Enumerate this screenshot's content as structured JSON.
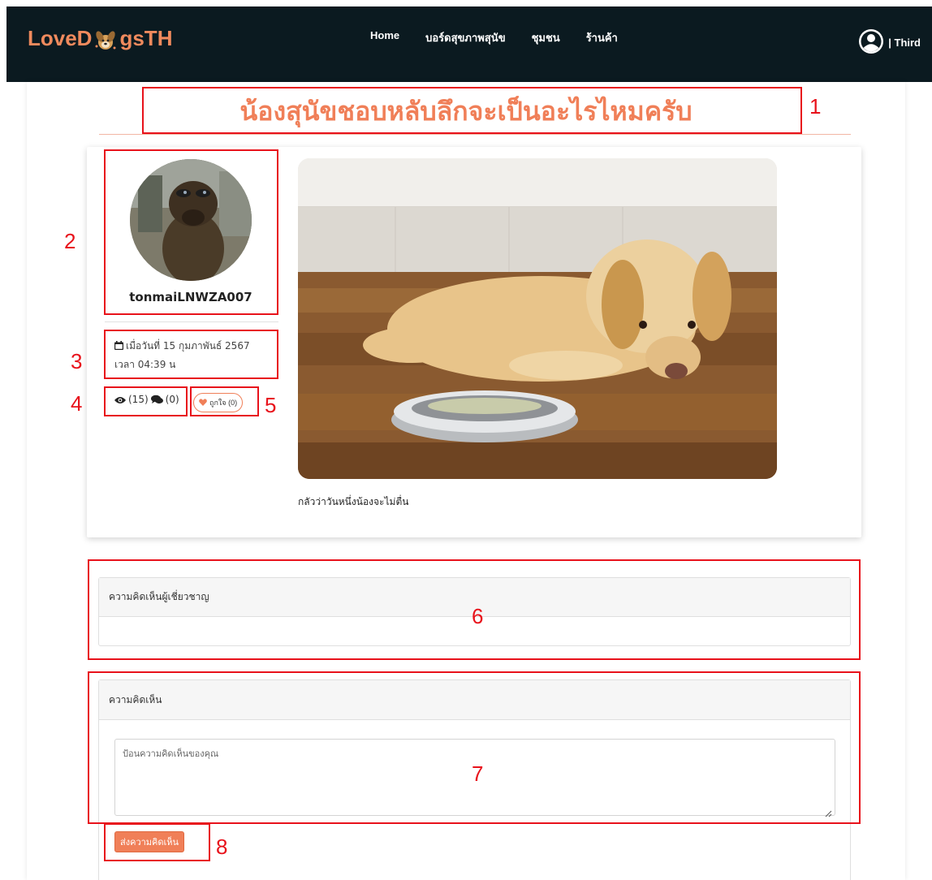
{
  "navbar": {
    "brand_pre": "LoveD",
    "brand_post": "gsTH",
    "links": [
      "Home",
      "บอร์ดสุขภาพสุนัข",
      "ชุมชน",
      "ร้านค้า"
    ],
    "user_label": "| Third"
  },
  "post": {
    "title": "น้องสุนัขชอบหลับลึกจะเป็นอะไรไหมครับ",
    "author": "tonmaiLNWZA007",
    "date_line1": "เมื่อวันที่ 15 กุมภาพันธ์ 2567",
    "date_line2": "เวลา 04:39 น",
    "views": "(15)",
    "comments": "(0)",
    "like_label": "ถูกใจ (0)",
    "caption": "กลัวว่าวันหนึ่งน้องจะไม่ตื่น"
  },
  "expert_panel": {
    "heading": "ความคิดเห็นผู้เชี่ยวชาญ"
  },
  "comment_panel": {
    "heading": "ความคิดเห็น",
    "placeholder": "ป้อนความคิดเห็นของคุณ",
    "submit_label": "ส่งความคิดเห็น"
  },
  "annotations": [
    "1",
    "2",
    "3",
    "4",
    "5",
    "6",
    "7",
    "8"
  ],
  "colors": {
    "accent": "#f07f58",
    "navbar_bg": "#0b1a20",
    "annotation": "#e8121b"
  }
}
